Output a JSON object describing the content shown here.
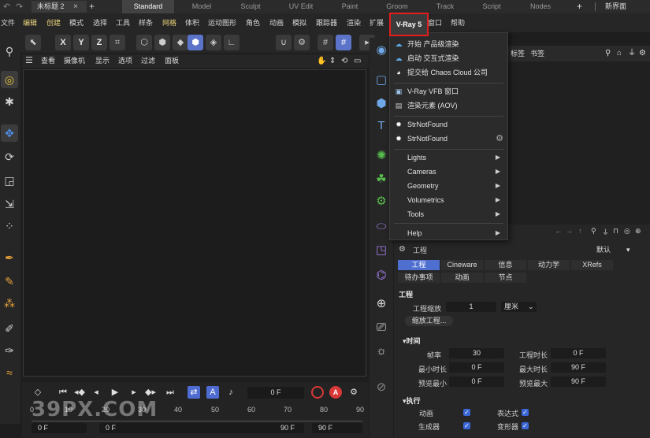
{
  "top": {
    "doc_tab": "未标题 2",
    "doc_close": "×",
    "new_tab": "+",
    "layouts": [
      "Standard",
      "Model",
      "Sculpt",
      "UV Edit",
      "Paint",
      "Groom",
      "Track",
      "Script",
      "Nodes"
    ],
    "active_layout": "Standard",
    "layout_plus": "+",
    "new_ui": "新界面"
  },
  "menubar": {
    "items": [
      "文件",
      "编辑",
      "创建",
      "模式",
      "选择",
      "工具",
      "样条",
      "网格",
      "体积",
      "运动图形",
      "角色",
      "动画",
      "模拟",
      "跟踪器",
      "渲染",
      "扩展",
      "V-Ray 5",
      "窗口",
      "帮助"
    ],
    "highlighted": [
      "编辑",
      "创建",
      "网格"
    ]
  },
  "toolbar": {
    "axis_x": "X",
    "axis_y": "Y",
    "axis_z": "Z"
  },
  "viewport": {
    "menu": [
      "查看",
      "摄像机",
      "显示",
      "选项",
      "过滤",
      "面板"
    ]
  },
  "vray_menu": {
    "items": [
      {
        "label": "开始 产品级渲染",
        "icon": "cloud-icon",
        "color": "#5fa8e0"
      },
      {
        "label": "启动 交互式渲染",
        "icon": "cloud-icon",
        "color": "#5fa8e0"
      },
      {
        "label": "提交给 Chaos Cloud 公司",
        "icon": "chaos-cloud-icon",
        "color": "#ffffff"
      },
      {
        "label": "V-Ray VFB 窗口",
        "icon": "vfb-window-icon",
        "color": "#9ec4e8"
      },
      {
        "label": "渲染元素 (AOV)",
        "icon": "render-elements-icon",
        "color": "#cccccc"
      },
      {
        "label": "StrNotFound",
        "icon": "vray-logo-icon",
        "color": "#ffffff"
      },
      {
        "label": "StrNotFound",
        "icon": "vray-logo-icon",
        "color": "#ffffff"
      },
      {
        "label": "Lights"
      },
      {
        "label": "Cameras"
      },
      {
        "label": "Geometry"
      },
      {
        "label": "Volumetrics"
      },
      {
        "label": "Tools"
      },
      {
        "label": "Help"
      }
    ]
  },
  "object_manager": {
    "tabs": [
      "标签",
      "书签"
    ]
  },
  "attributes": {
    "title": "工程",
    "mode": "默认",
    "tabs": [
      "工程",
      "Cineware",
      "信息",
      "动力学",
      "XRefs"
    ],
    "active_tab": "工程",
    "subtabs": [
      "待办事项",
      "动画",
      "节点"
    ],
    "section_project": "工程",
    "project_scale_label": "工程缩放",
    "project_scale_value": "1",
    "project_scale_unit": "厘米",
    "scale_project_button": "缩放工程...",
    "section_time": "时间",
    "fps_label": "帧率",
    "fps_value": "30",
    "duration_label": "工程时长",
    "duration_value": "0 F",
    "min_time_label": "最小时长",
    "min_time_value": "0 F",
    "max_time_label": "最大时长",
    "max_time_value": "90 F",
    "preview_min_label": "预览最小",
    "preview_min_value": "0 F",
    "preview_max_label": "预览最大",
    "preview_max_value": "90 F",
    "section_exec": "执行",
    "animation_label": "动画",
    "expression_label": "表达式",
    "generator_label": "生成器",
    "deformer_label": "变形器"
  },
  "timeline": {
    "frame": "0 F",
    "ruler": [
      "0",
      "10",
      "20",
      "30",
      "40",
      "50",
      "60",
      "70",
      "80",
      "90"
    ],
    "range_start": "0 F",
    "range_start2": "0 F",
    "range_end": "90 F",
    "range_end2": "90 F"
  },
  "watermark": "39PX.COM",
  "colors": {
    "accent": "#4f6fd0",
    "highlight_box": "#e21d1d",
    "record": "#d93838"
  }
}
